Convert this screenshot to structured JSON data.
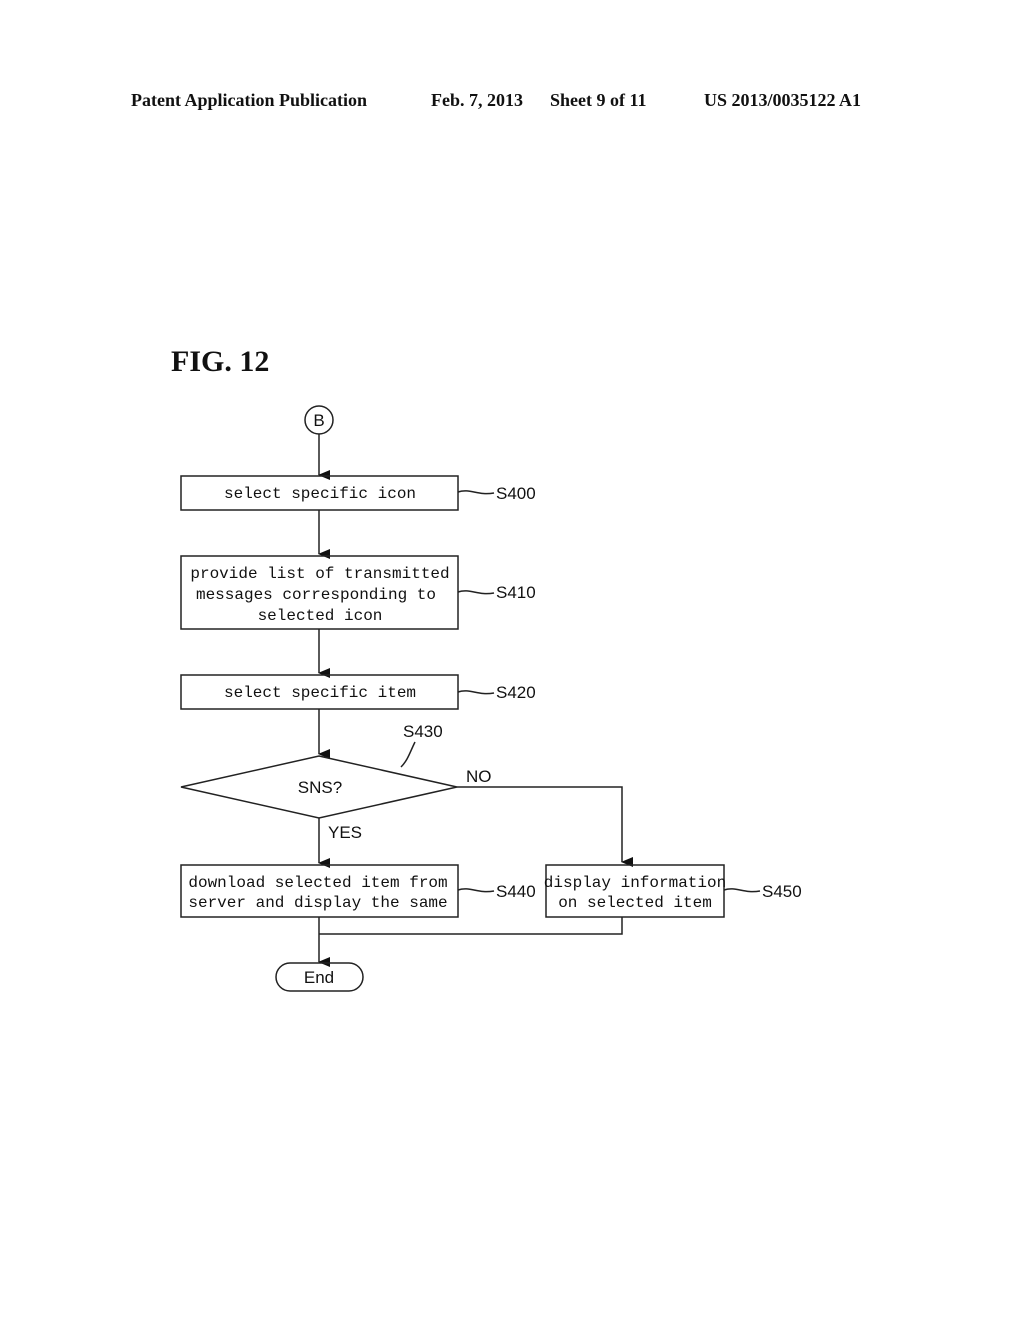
{
  "header": {
    "publication": "Patent Application Publication",
    "date": "Feb. 7, 2013",
    "sheet": "Sheet 9 of 11",
    "number": "US 2013/0035122 A1"
  },
  "figure": {
    "title": "FIG. 12",
    "start_connector": "B",
    "end_terminal": "End",
    "steps": [
      {
        "id": "S400",
        "lines": [
          "select specific icon"
        ]
      },
      {
        "id": "S410",
        "lines": [
          "provide list of transmitted",
          "messages corresponding to",
          "selected icon"
        ]
      },
      {
        "id": "S420",
        "lines": [
          "select specific item"
        ]
      },
      {
        "id": "S430",
        "lines": [
          "SNS?"
        ],
        "type": "decision"
      },
      {
        "id": "S440",
        "lines": [
          "download selected item from",
          "server and display the same"
        ]
      },
      {
        "id": "S450",
        "lines": [
          "display information",
          "on selected item"
        ]
      }
    ],
    "branches": {
      "yes": "YES",
      "no": "NO"
    }
  }
}
